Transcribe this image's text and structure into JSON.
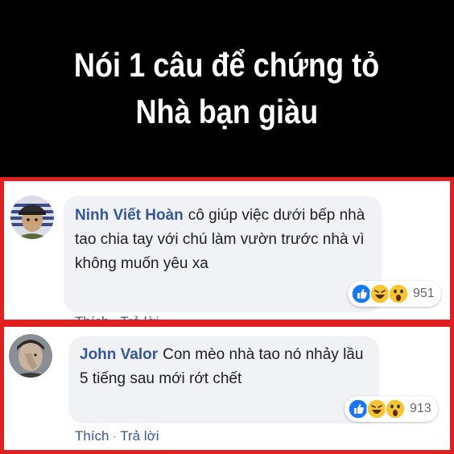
{
  "header": {
    "line1": "Nói 1 câu để chứng tỏ",
    "line2": "Nhà bạn giàu"
  },
  "comments": [
    {
      "author": "Ninh Viết Hoàn",
      "text": "cô giúp việc dưới bếp nhà tao chia tay với chú làm vườn trước nhà vì không muốn yêu xa",
      "reaction_count": "951",
      "like_label": "Thích",
      "reply_label": "Trả lời"
    },
    {
      "author": "John Valor",
      "text": "Con mèo nhà tao nó nhảy lầu 5 tiếng sau mới rớt chết",
      "reaction_count": "913",
      "like_label": "Thích",
      "reply_label": "Trả lời"
    }
  ],
  "colors": {
    "border": "#e0201e",
    "author": "#365899",
    "bubble": "#f0f2f5",
    "like_blue": "#1877f2",
    "haha_yellow": "#f7c531"
  },
  "icons": [
    "like-reaction-icon",
    "haha-reaction-icon",
    "wow-reaction-icon"
  ]
}
